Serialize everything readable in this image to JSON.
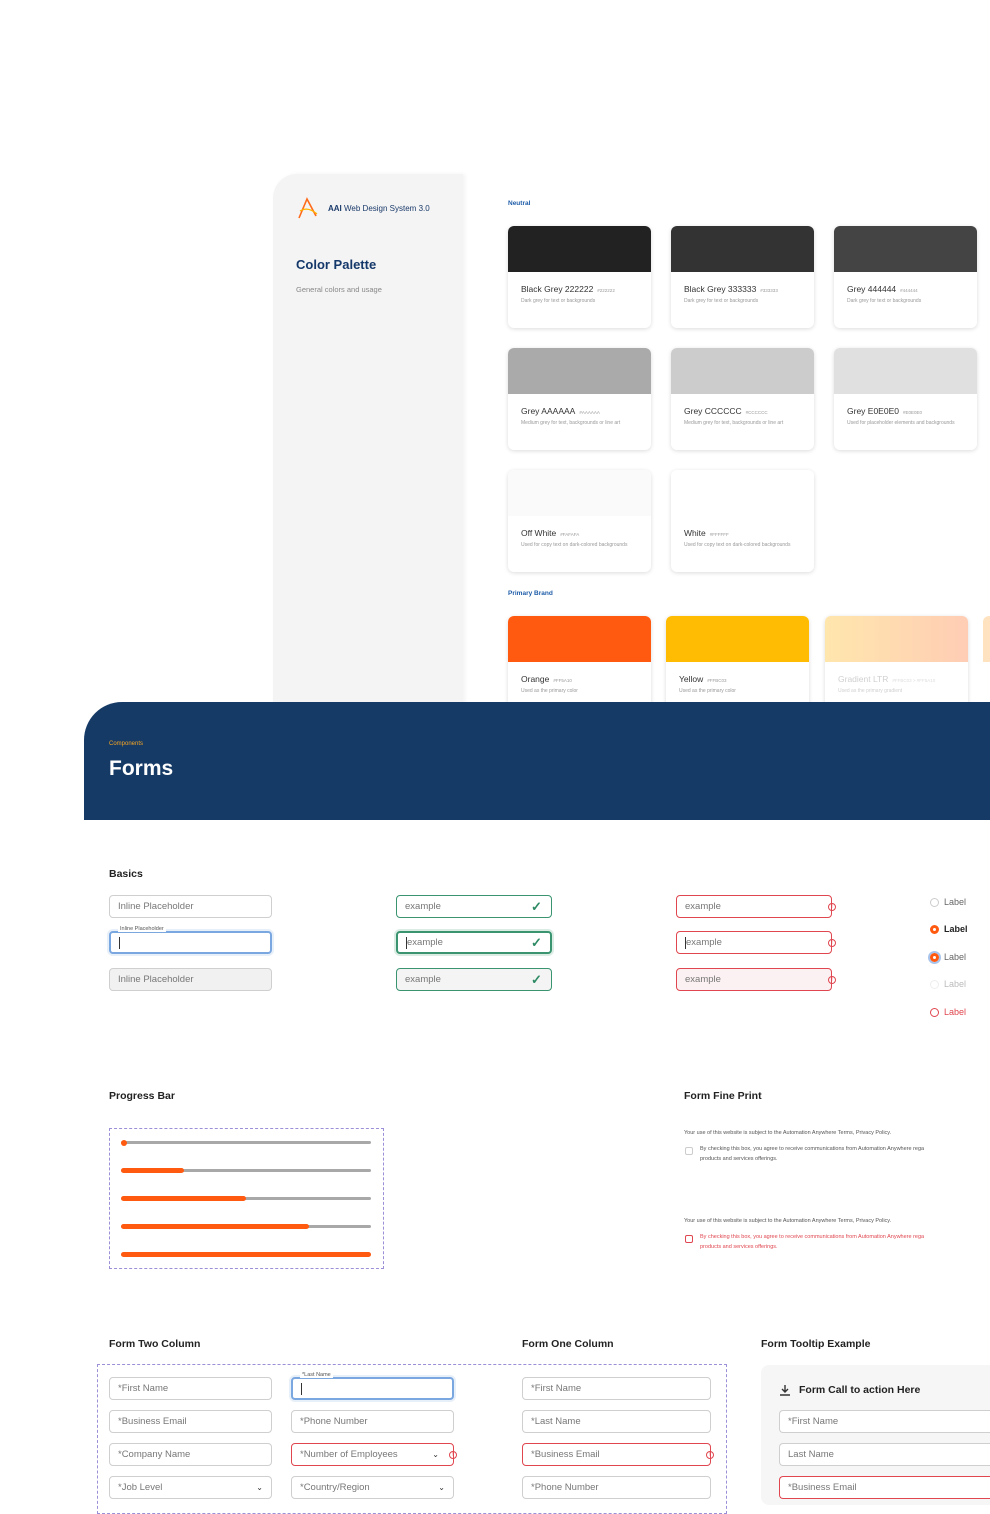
{
  "palette": {
    "brand_prefix": "AAI",
    "brand_name": "Web Design System 3.0",
    "title": "Color Palette",
    "subtitle": "General colors and usage",
    "neutral_label": "Neutral",
    "primary_label": "Primary Brand",
    "neutral": [
      {
        "name": "Black Grey 222222",
        "hex": "#222222",
        "desc": "Dark grey for text or backgrounds",
        "color": "#222222"
      },
      {
        "name": "Black Grey 333333",
        "hex": "#333333",
        "desc": "Dark grey for text or backgrounds",
        "color": "#333333"
      },
      {
        "name": "Grey 444444",
        "hex": "#444444",
        "desc": "Dark grey for text or backgrounds",
        "color": "#444444"
      },
      {
        "name": "Grey AAAAAA",
        "hex": "#AAAAAA",
        "desc": "Medium grey for text, backgrounds or line art",
        "color": "#aaaaaa"
      },
      {
        "name": "Grey CCCCCC",
        "hex": "#CCCCCC",
        "desc": "Medium grey for text, backgrounds or line art",
        "color": "#cccccc"
      },
      {
        "name": "Grey E0E0E0",
        "hex": "#E0E0E0",
        "desc": "Used for placeholder elements and backgrounds",
        "color": "#e0e0e0"
      },
      {
        "name": "Off White",
        "hex": "#FAFAFA",
        "desc": "Used for copy text on dark-colored backgrounds",
        "color": "#fafafa"
      },
      {
        "name": "White",
        "hex": "#FFFFFF",
        "desc": "Used for copy text on dark-colored backgrounds",
        "color": "#ffffff"
      }
    ],
    "primary": [
      {
        "name": "Orange",
        "hex": "#FF5A10",
        "desc": "Used as the primary color",
        "color": "#ff5a10"
      },
      {
        "name": "Yellow",
        "hex": "#FFBC03",
        "desc": "Used as the primary color",
        "color": "#ffbc03"
      },
      {
        "name": "Gradient LTR",
        "hex": "#FFBC03 > #FF5A10",
        "desc": "Used as the primary gradient",
        "color": "linear-gradient(90deg,#ffe3a8,#ffc9b0)"
      }
    ]
  },
  "forms": {
    "eyebrow": "Components",
    "title": "Forms",
    "basics_title": "Basics",
    "inline_placeholder": "Inline Placeholder",
    "floating_label": "Inline Placeholder",
    "example": "example",
    "radio_label": "Label",
    "progress_title": "Progress Bar",
    "progress_values": [
      0,
      25,
      50,
      75,
      100
    ],
    "fineprint_title": "Form Fine Print",
    "fineprint_terms": "Your use of this website is subject to the Automation Anywhere Terms, Privacy Policy.",
    "fineprint_consent_1": "By checking this box, you agree to receive communications from Automation Anywhere rega",
    "fineprint_consent_2": "products and services offerings.",
    "two_col_title": "Form Two Column",
    "one_col_title": "Form One Column",
    "tooltip_title": "Form Tooltip Example",
    "two_col_left": [
      "*First Name",
      "*Business Email",
      "*Company Name",
      "*Job Level"
    ],
    "two_col_right_label": "*Last Name",
    "two_col_right": [
      "*Phone Number",
      "*Number of Employees",
      "*Country/Region"
    ],
    "one_col": [
      "*First Name",
      "*Last Name",
      "*Business Email",
      "*Phone Number"
    ],
    "cta_title": "Form Call to action Here",
    "tooltip_fields": [
      "*First Name",
      "Last Name",
      "*Business Email"
    ]
  },
  "colors": {
    "orange": "#FF5A10",
    "navy": "#163A66",
    "success": "#3A9470",
    "error": "#E0464F"
  }
}
